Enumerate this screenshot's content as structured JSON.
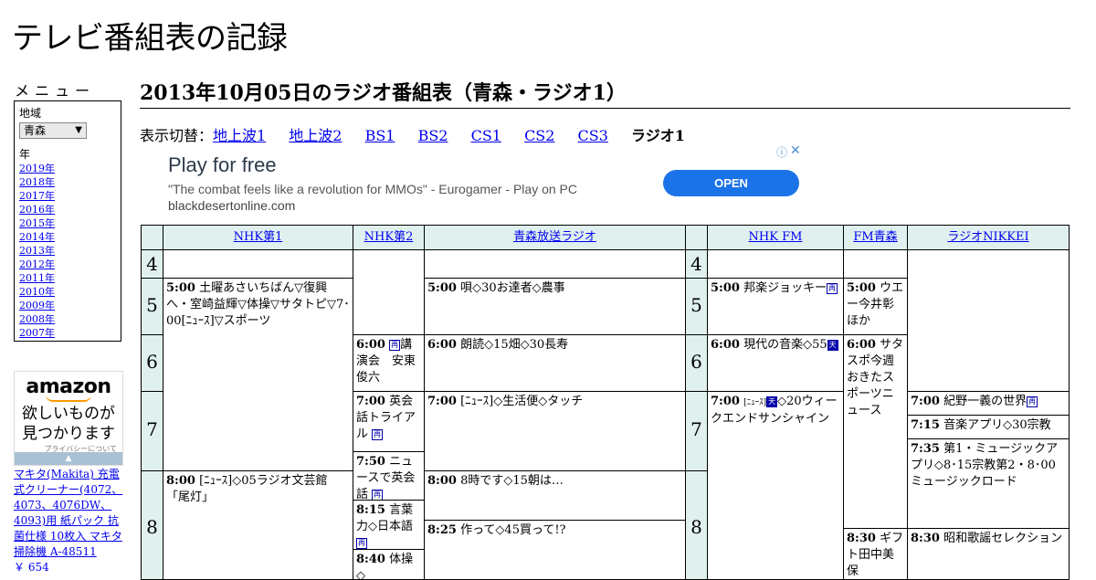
{
  "site": {
    "title": "テレビ番組表の記録"
  },
  "menu": {
    "title": "メニュー",
    "region_label": "地域",
    "region_value": "青森",
    "year_label": "年",
    "years": [
      "2019年",
      "2018年",
      "2017年",
      "2016年",
      "2015年",
      "2014年",
      "2013年",
      "2012年",
      "2011年",
      "2010年",
      "2009年",
      "2008年",
      "2007年"
    ]
  },
  "amazon": {
    "logo": "amazon",
    "tagline_1": "欲しいものが",
    "tagline_2": "見つかります",
    "privacy": "プライバシーについて",
    "product": "マキタ(Makita) 充電式クリーナー(4072、4073、4076DW、4093)用 紙パック 抗菌仕様 10枚入 マキタ 掃除機 A-48511",
    "price": "￥ 654"
  },
  "page": {
    "title": "2013年10月05日のラジオ番組表（青森・ラジオ1）"
  },
  "switcher": {
    "label": "表示切替：",
    "links": [
      "地上波1",
      "地上波2",
      "BS1",
      "BS2",
      "CS1",
      "CS2",
      "CS3"
    ],
    "current": "ラジオ1"
  },
  "ad": {
    "headline": "Play for free",
    "desc": "\"The combat feels like a revolution for MMOs\" - Eurogamer - Play on PC",
    "domain": "blackdesertonline.com",
    "cta": "OPEN",
    "info_icon": "info-icon",
    "close_icon": "close-icon"
  },
  "grid": {
    "stations": [
      "NHK第1",
      "NHK第2",
      "青森放送ラジオ",
      "NHK FM",
      "FM青森",
      "ラジオNIKKEI"
    ],
    "hours": [
      "4",
      "5",
      "6",
      "7",
      "8"
    ],
    "programs": {
      "nhk1_500_time": "5:00",
      "nhk1_500_text": "土曜あさいちばん▽復興へ・室崎益輝▽体操▽サタトピ▽7･00[ﾆｭｰｽ]▽スポーツ",
      "nhk1_800_time": "8:00",
      "nhk1_800_text": "[ﾆｭｰｽ]◇05ラジオ文芸館「尾灯」",
      "nhk2_600_time": "6:00",
      "nhk2_600_text": "講演会　安東俊六",
      "nhk2_700_time": "7:00",
      "nhk2_700_text": "英会話トライアル",
      "nhk2_750_time": "7:50",
      "nhk2_750_text": "ニュースで英会話",
      "nhk2_815_time": "8:15",
      "nhk2_815_text": "言葉力◇日本語",
      "nhk2_840_time": "8:40",
      "nhk2_840_text": "体操◇",
      "rab_500_time": "5:00",
      "rab_500_text": "唄◇30お達者◇農事",
      "rab_600_time": "6:00",
      "rab_600_text": "朗読◇15畑◇30長寿",
      "rab_700_time": "7:00",
      "rab_700_text": "[ﾆｭｰｽ]◇生活便◇タッチ",
      "rab_800_time": "8:00",
      "rab_800_text": "8時です◇15朝は…",
      "rab_825_time": "8:25",
      "rab_825_text": "作って◇45買って!?",
      "fm_500_time": "5:00",
      "fm_500_text": "邦楽ジョッキー",
      "fm_600_time": "6:00",
      "fm_600_text": "現代の音楽◇55",
      "fm_700_time": "7:00",
      "fm_700_text": "[ﾆｭｰｽ]",
      "fm_700_text2": "◇20ウィークエンドサンシャイン",
      "afb_500_time": "5:00",
      "afb_500_text": "ウエー今井彰ほか",
      "afb_600_time": "6:00",
      "afb_600_text": "サタスポ今週おきたスポーツニュース",
      "afb_830_time": "8:30",
      "afb_830_text": "ギフト田中美保",
      "nikkei_700_time": "7:00",
      "nikkei_700_text": "紀野一義の世界",
      "nikkei_715_time": "7:15",
      "nikkei_715_text": "音楽アプリ◇30宗教",
      "nikkei_735_time": "7:35",
      "nikkei_735_text": "第1・ミュージックアプリ◇8･15宗教第2・8･00ミュージックロード",
      "nikkei_830_time": "8:30",
      "nikkei_830_text": "昭和歌謡セレクション"
    },
    "marks": {
      "ni": "再",
      "ten": "天",
      "bunka": "文"
    }
  }
}
